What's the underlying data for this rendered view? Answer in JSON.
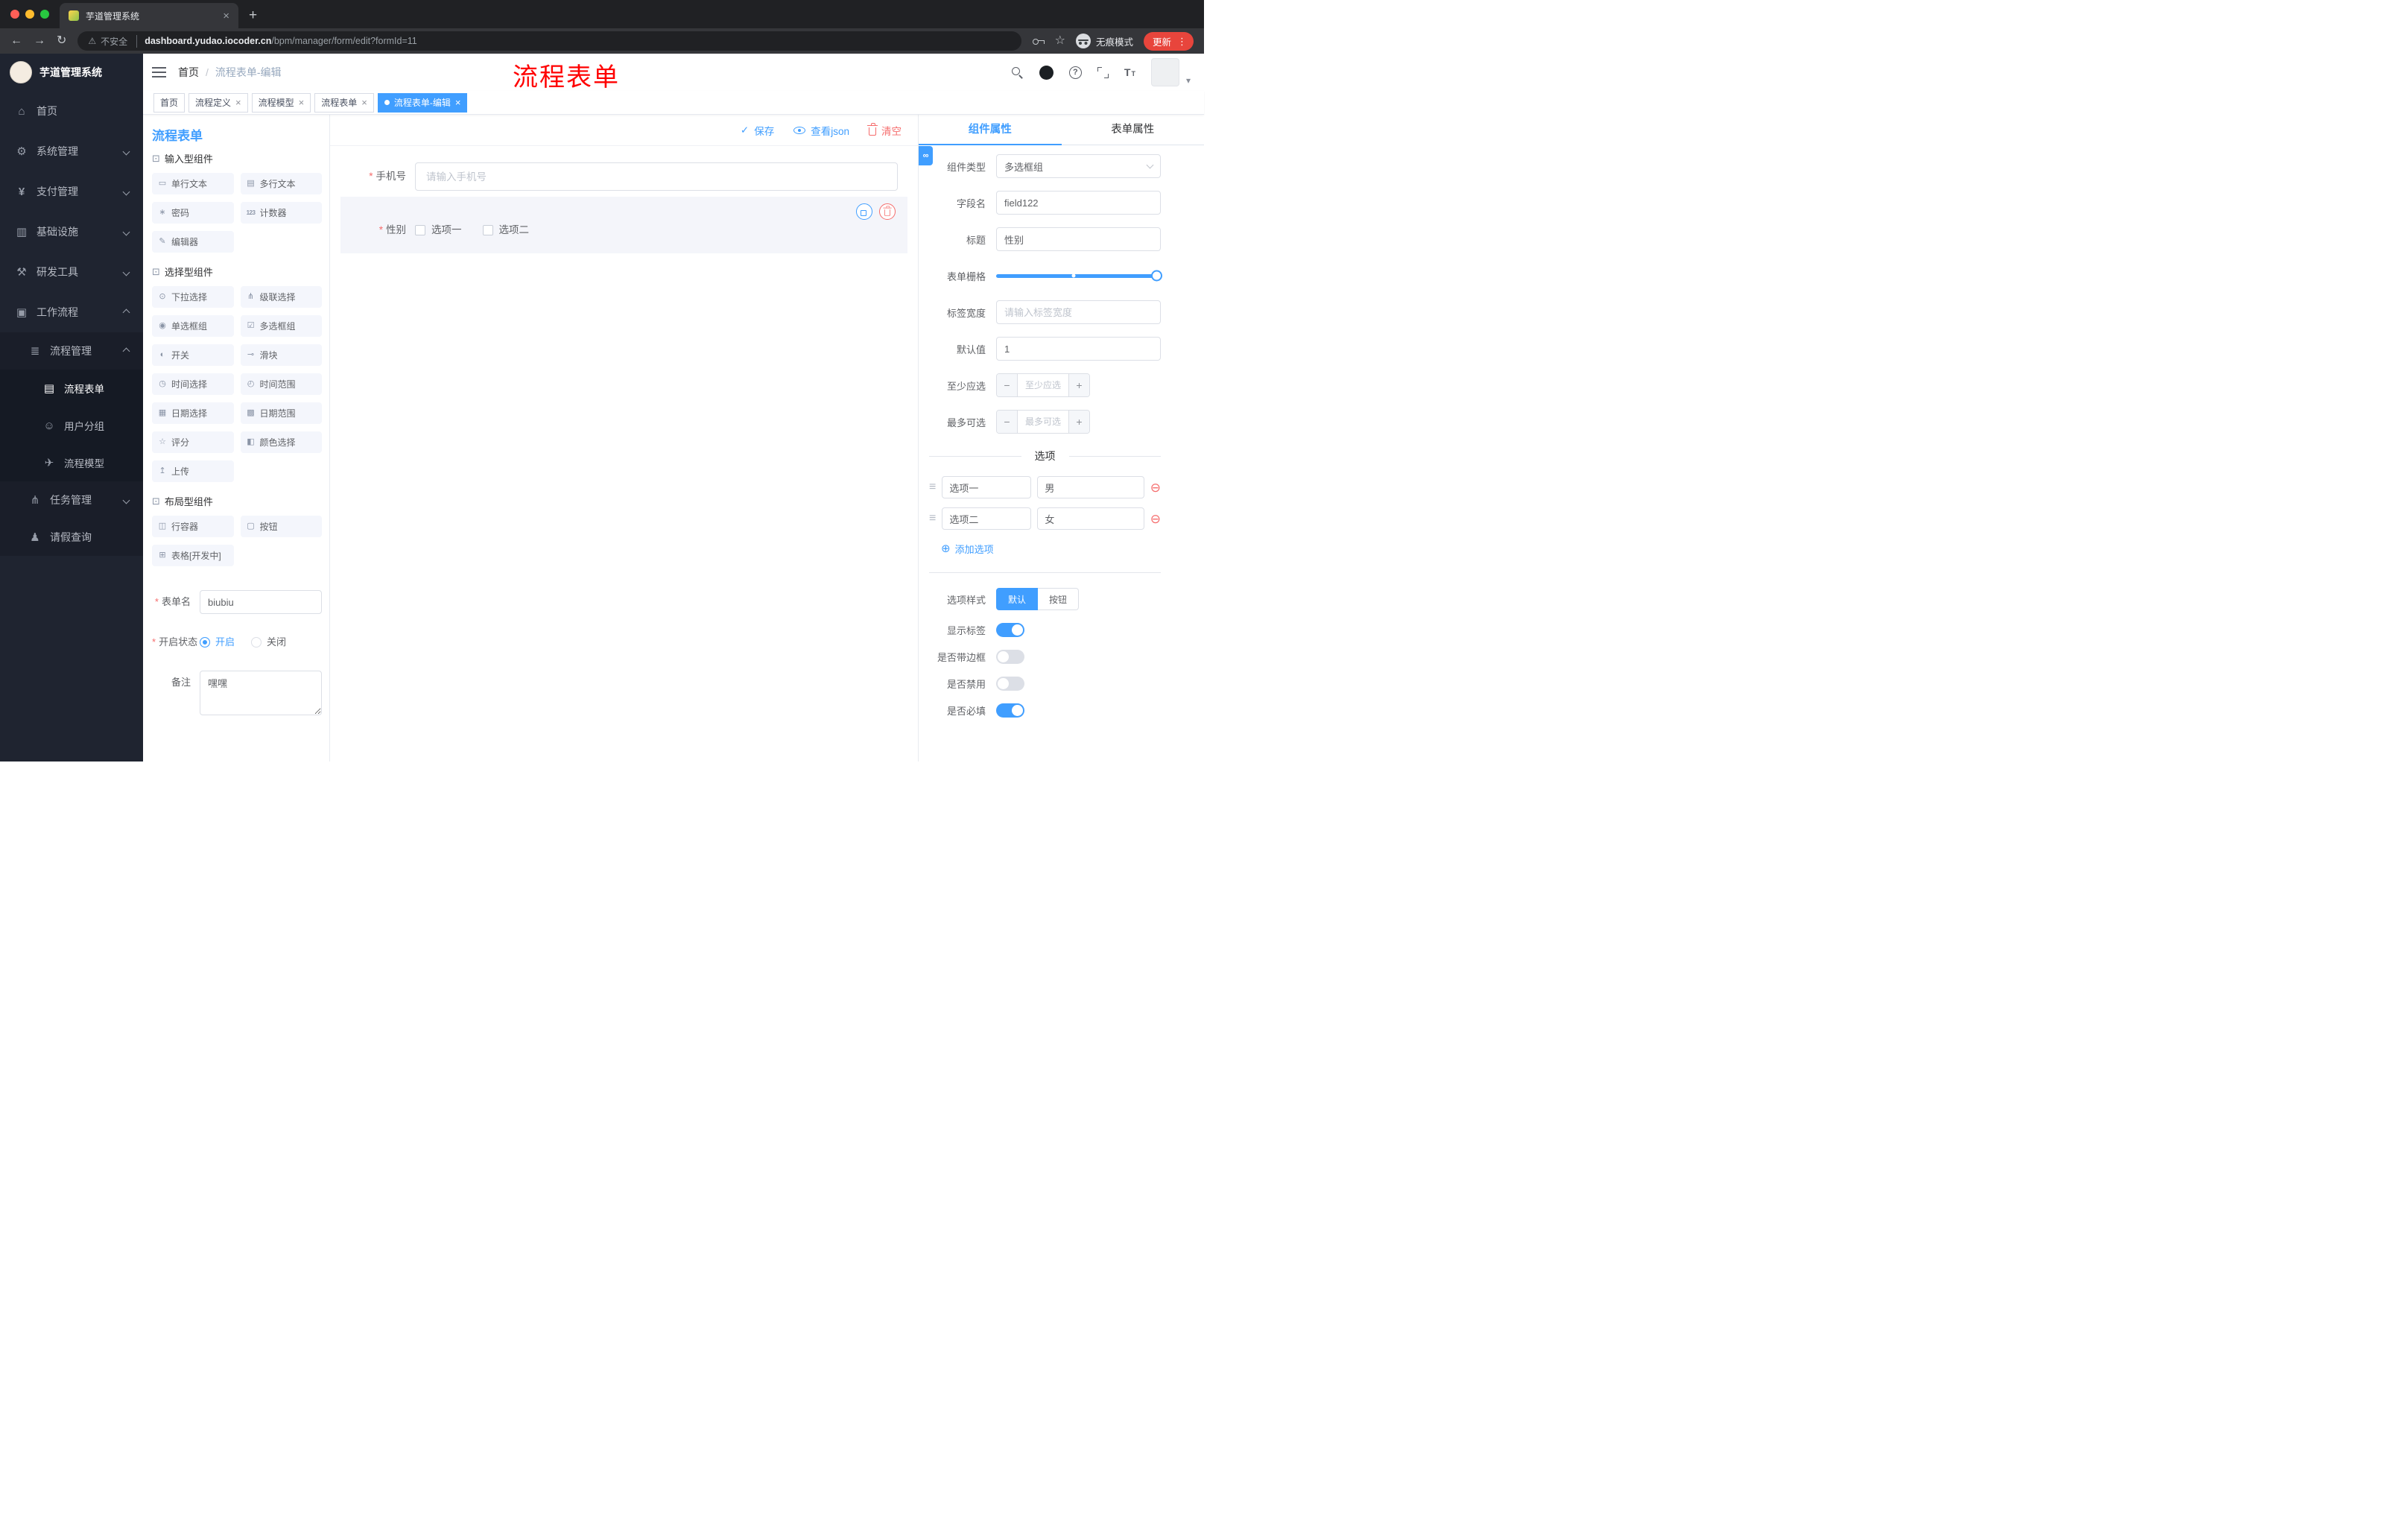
{
  "accent_color": "#409eff",
  "danger_color": "#f56c6c",
  "browser": {
    "tab_title": "芋道管理系统",
    "security_label": "不安全",
    "url_host": "dashboard.yudao.iocoder.cn",
    "url_path": "/bpm/manager/form/edit?formId=11",
    "incognito_label": "无痕模式",
    "update_label": "更新"
  },
  "sidebar": {
    "logo_text": "芋道管理系统",
    "menu": [
      {
        "label": "首页",
        "icon": "dashboard-icon",
        "level": 0
      },
      {
        "label": "系统管理",
        "icon": "gear-icon",
        "level": 0,
        "chevron": "down"
      },
      {
        "label": "支付管理",
        "icon": "payment-icon",
        "level": 0,
        "chevron": "down"
      },
      {
        "label": "基础设施",
        "icon": "infrastructure-icon",
        "level": 0,
        "chevron": "down"
      },
      {
        "label": "研发工具",
        "icon": "dev-tools-icon",
        "level": 0,
        "chevron": "down"
      },
      {
        "label": "工作流程",
        "icon": "workflow-icon",
        "level": 0,
        "chevron": "up",
        "expanded": true
      },
      {
        "label": "流程管理",
        "icon": "process-manage-icon",
        "level": 1,
        "chevron": "up",
        "expanded": true
      },
      {
        "label": "流程表单",
        "icon": "process-form-icon",
        "level": 2,
        "active": true
      },
      {
        "label": "用户分组",
        "icon": "user-group-icon",
        "level": 2
      },
      {
        "label": "流程模型",
        "icon": "process-model-icon",
        "level": 2
      },
      {
        "label": "任务管理",
        "icon": "task-manage-icon",
        "level": 1,
        "chevron": "down"
      },
      {
        "label": "请假查询",
        "icon": "leave-query-icon",
        "level": 1
      }
    ]
  },
  "header": {
    "breadcrumb_home": "首页",
    "breadcrumb_current": "流程表单-编辑",
    "annotation": "流程表单",
    "icons": [
      "search-icon",
      "github-icon",
      "help-icon",
      "fullscreen-icon",
      "font-size-icon",
      "avatar"
    ]
  },
  "tags": [
    {
      "label": "首页",
      "closable": false,
      "active": false
    },
    {
      "label": "流程定义",
      "closable": true,
      "active": false
    },
    {
      "label": "流程模型",
      "closable": true,
      "active": false
    },
    {
      "label": "流程表单",
      "closable": true,
      "active": false
    },
    {
      "label": "流程表单-编辑",
      "closable": true,
      "active": true
    }
  ],
  "palette": {
    "title": "流程表单",
    "input": {
      "title": "输入型组件",
      "items": [
        {
          "label": "单行文本",
          "icon": "text-field-icon"
        },
        {
          "label": "多行文本",
          "icon": "textarea-icon"
        },
        {
          "label": "密码",
          "icon": "password-icon"
        },
        {
          "label": "计数器",
          "icon": "counter-icon"
        },
        {
          "label": "编辑器",
          "icon": "editor-icon"
        }
      ]
    },
    "select": {
      "title": "选择型组件",
      "items": [
        {
          "label": "下拉选择",
          "icon": "select-icon"
        },
        {
          "label": "级联选择",
          "icon": "cascader-icon"
        },
        {
          "label": "单选框组",
          "icon": "radio-group-icon"
        },
        {
          "label": "多选框组",
          "icon": "checkbox-group-icon"
        },
        {
          "label": "开关",
          "icon": "switch-icon"
        },
        {
          "label": "滑块",
          "icon": "slider-icon"
        },
        {
          "label": "时间选择",
          "icon": "time-picker-icon"
        },
        {
          "label": "时间范围",
          "icon": "time-range-icon"
        },
        {
          "label": "日期选择",
          "icon": "date-picker-icon"
        },
        {
          "label": "日期范围",
          "icon": "date-range-icon"
        },
        {
          "label": "评分",
          "icon": "rate-icon"
        },
        {
          "label": "颜色选择",
          "icon": "color-picker-icon"
        },
        {
          "label": "上传",
          "icon": "upload-icon"
        }
      ]
    },
    "layout": {
      "title": "布局型组件",
      "items": [
        {
          "label": "行容器",
          "icon": "row-container-icon"
        },
        {
          "label": "按钮",
          "icon": "button-icon"
        },
        {
          "label": "表格[开发中]",
          "icon": "table-icon"
        }
      ]
    },
    "form": {
      "name_label": "表单名",
      "name_value": "biubiu",
      "status_label": "开启状态",
      "status_on": "开启",
      "status_off": "关闭",
      "status_selected": "开启",
      "remark_label": "备注",
      "remark_value": "嘿嘿"
    }
  },
  "canvas": {
    "save_label": "保存",
    "view_json_label": "查看json",
    "clear_label": "清空",
    "phone_label": "手机号",
    "phone_placeholder": "请输入手机号",
    "gender_label": "性别",
    "gender_option1": "选项一",
    "gender_option2": "选项二"
  },
  "props": {
    "tab_component": "组件属性",
    "tab_form": "表单属性",
    "component_type_label": "组件类型",
    "component_type_value": "多选框组",
    "field_name_label": "字段名",
    "field_name_value": "field122",
    "title_label": "标题",
    "title_value": "性别",
    "grid_label": "表单栅格",
    "label_width_label": "标签宽度",
    "label_width_placeholder": "请输入标签宽度",
    "default_label": "默认值",
    "default_value": "1",
    "min_label": "至少应选",
    "min_placeholder": "至少应选",
    "max_label": "最多可选",
    "max_placeholder": "最多可选",
    "options_title": "选项",
    "options": [
      {
        "label": "选项一",
        "value": "男"
      },
      {
        "label": "选项二",
        "value": "女"
      }
    ],
    "add_option_label": "添加选项",
    "option_style_label": "选项样式",
    "style_default": "默认",
    "style_button": "按钮",
    "style_active": "默认",
    "show_label_label": "显示标签",
    "show_label_on": true,
    "border_label": "是否带边框",
    "border_on": false,
    "disabled_label": "是否禁用",
    "disabled_on": false,
    "required_label": "是否必填",
    "required_on": true
  }
}
